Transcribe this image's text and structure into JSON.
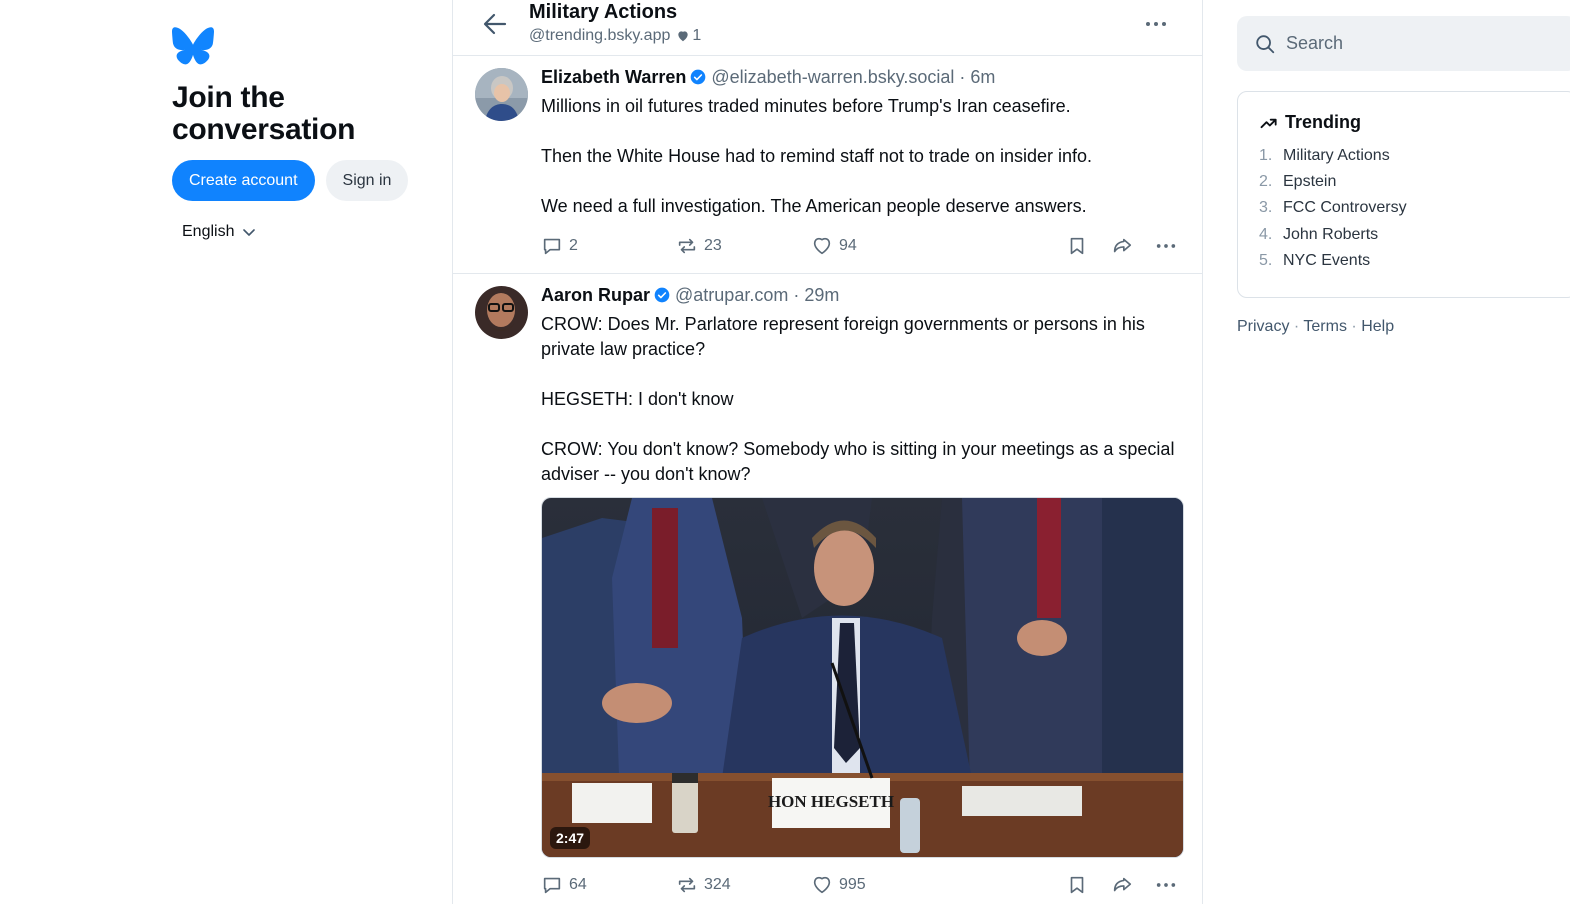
{
  "left": {
    "join_title": "Join the conversation",
    "create_account": "Create account",
    "sign_in": "Sign in",
    "language": "English"
  },
  "feed": {
    "title": "Military Actions",
    "handle": "@trending.bsky.app",
    "likes": "1"
  },
  "posts": [
    {
      "name": "Elizabeth Warren",
      "handle": "@elizabeth-warren.bsky.social",
      "time": "6m",
      "text": "Millions in oil futures traded minutes before Trump's Iran ceasefire.\n\nThen the White House had to remind staff not to trade on insider info.\n\nWe need a full investigation. The American people deserve answers.",
      "replies": "2",
      "reposts": "23",
      "likes": "94"
    },
    {
      "name": "Aaron Rupar",
      "handle": "@atrupar.com",
      "time": "29m",
      "text": "CROW: Does Mr. Parlatore represent foreign governments or persons in his private law practice?\n\nHEGSETH: I don't know\n\nCROW: You don't know? Somebody who is sitting in your meetings as a special adviser -- you don't know?",
      "video_duration": "2:47",
      "nameplate": "HON HEGSETH",
      "replies": "64",
      "reposts": "324",
      "likes": "995"
    }
  ],
  "search": {
    "placeholder": "Search"
  },
  "trending": {
    "title": "Trending",
    "items": [
      {
        "num": "1.",
        "label": "Military Actions"
      },
      {
        "num": "2.",
        "label": "Epstein"
      },
      {
        "num": "3.",
        "label": "FCC Controversy"
      },
      {
        "num": "4.",
        "label": "John Roberts"
      },
      {
        "num": "5.",
        "label": "NYC Events"
      }
    ]
  },
  "footer": {
    "privacy": "Privacy",
    "terms": "Terms",
    "help": "Help",
    "sep": "·"
  },
  "colors": {
    "accent": "#1083fe",
    "text": "#0b0f14",
    "muted": "#5b6a78",
    "border": "#e3e8ed"
  }
}
